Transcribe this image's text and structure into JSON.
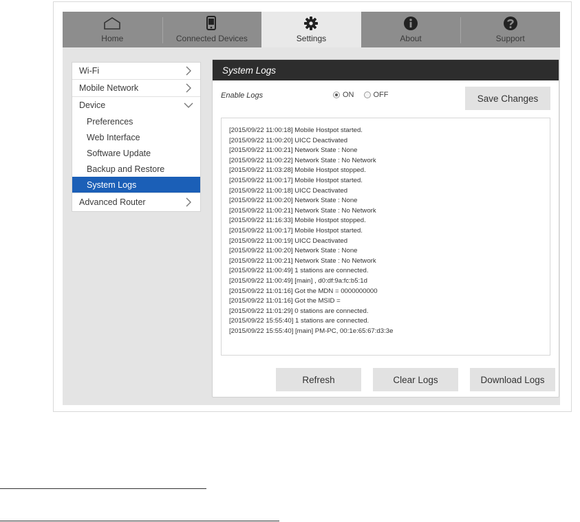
{
  "nav": {
    "tabs": [
      {
        "label": "Home",
        "icon": "home-icon",
        "active": false
      },
      {
        "label": "Connected Devices",
        "icon": "device-icon",
        "active": false
      },
      {
        "label": "Settings",
        "icon": "gear-icon",
        "active": true
      },
      {
        "label": "About",
        "icon": "info-icon",
        "active": false
      },
      {
        "label": "Support",
        "icon": "help-icon",
        "active": false
      }
    ]
  },
  "sidebar": {
    "items": [
      {
        "label": "Wi-Fi"
      },
      {
        "label": "Mobile Network"
      },
      {
        "label": "Device"
      },
      {
        "label": "Advanced Router"
      }
    ],
    "device_sub": [
      {
        "label": "Preferences"
      },
      {
        "label": "Web Interface"
      },
      {
        "label": "Software Update"
      },
      {
        "label": "Backup and Restore"
      },
      {
        "label": "System Logs"
      }
    ],
    "active_color": "#1b5fb7"
  },
  "panel": {
    "title": "System Logs",
    "enable_label": "Enable Logs",
    "on_label": "ON",
    "off_label": "OFF",
    "enabled": "ON",
    "save_label": "Save Changes",
    "logs": [
      "[2015/09/22 11:00:18] Mobile Hostpot started.",
      "[2015/09/22 11:00:20] UICC Deactivated",
      "[2015/09/22 11:00:21] Network State : None",
      "[2015/09/22 11:00:22] Network State : No Network",
      "[2015/09/22 11:03:28] Mobile Hostpot stopped.",
      "[2015/09/22 11:00:17] Mobile Hostpot started.",
      "[2015/09/22 11:00:18] UICC Deactivated",
      "[2015/09/22 11:00:20] Network State : None",
      "[2015/09/22 11:00:21] Network State : No Network",
      "[2015/09/22 11:16:33] Mobile Hostpot stopped.",
      "[2015/09/22 11:00:17] Mobile Hostpot started.",
      "[2015/09/22 11:00:19] UICC Deactivated",
      "[2015/09/22 11:00:20] Network State : None",
      "[2015/09/22 11:00:21] Network State : No Network",
      "[2015/09/22 11:00:49] 1 stations are connected.",
      "[2015/09/22 11:00:49] [main] , d0:df:9a:fc:b5:1d",
      "[2015/09/22 11:01:16] Got the MDN = 0000000000",
      "[2015/09/22 11:01:16] Got the MSID =",
      "[2015/09/22 11:01:29] 0 stations are connected.",
      "[2015/09/22 15:55:40] 1 stations are connected.",
      "[2015/09/22 15:55:40] [main] PM-PC, 00:1e:65:67:d3:3e"
    ],
    "refresh_label": "Refresh",
    "clear_label": "Clear Logs",
    "download_label": "Download Logs"
  }
}
